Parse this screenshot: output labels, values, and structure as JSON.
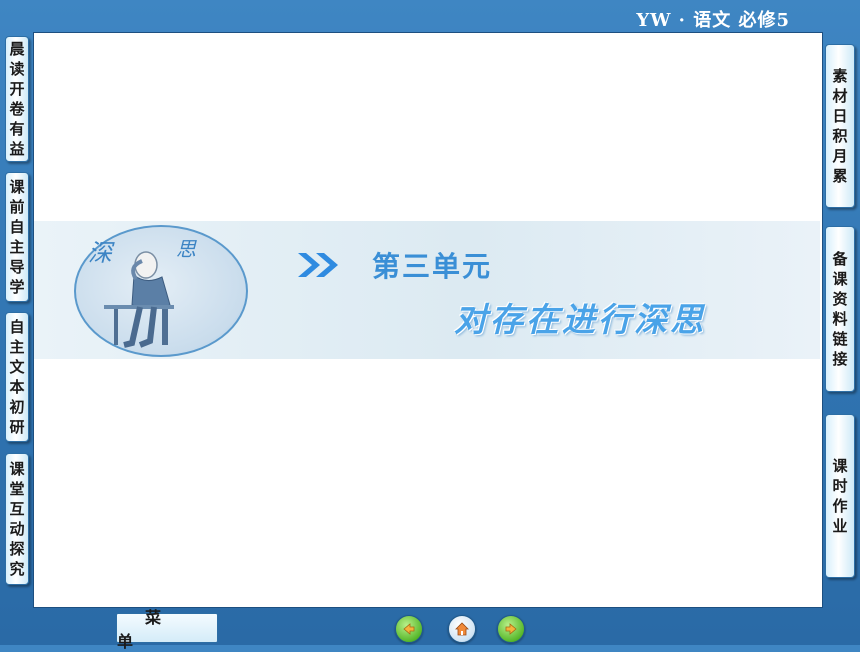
{
  "header": {
    "title": "YW · 语文    必修5"
  },
  "left_tabs": [
    {
      "label": [
        "晨",
        "读",
        "开",
        "卷",
        "有",
        "益"
      ]
    },
    {
      "label": [
        "课",
        "前",
        "自",
        "主",
        "导",
        "学"
      ]
    },
    {
      "label": [
        "自",
        "主",
        "文",
        "本",
        "初",
        "研"
      ]
    },
    {
      "label": [
        "课",
        "堂",
        "互",
        "动",
        "探",
        "究"
      ]
    }
  ],
  "right_tabs": [
    {
      "label": [
        "素",
        "材",
        "日",
        "积",
        "月",
        "累"
      ]
    },
    {
      "label": [
        "备",
        "课",
        "资",
        "料",
        "链",
        "接"
      ]
    },
    {
      "label": [
        "课",
        "时",
        "作",
        "业"
      ]
    }
  ],
  "banner": {
    "deco_left": "深",
    "deco_right": "思",
    "unit": "第三单元",
    "subtitle": "对存在进行深思"
  },
  "footer": {
    "menu_label": "菜单",
    "nav_icons": [
      "prev-arrow-icon",
      "home-icon",
      "next-arrow-icon"
    ]
  },
  "colors": {
    "background": "#3f86c3",
    "accent_text": "#3a8fd6",
    "tab_border": "#2d6ea5"
  }
}
